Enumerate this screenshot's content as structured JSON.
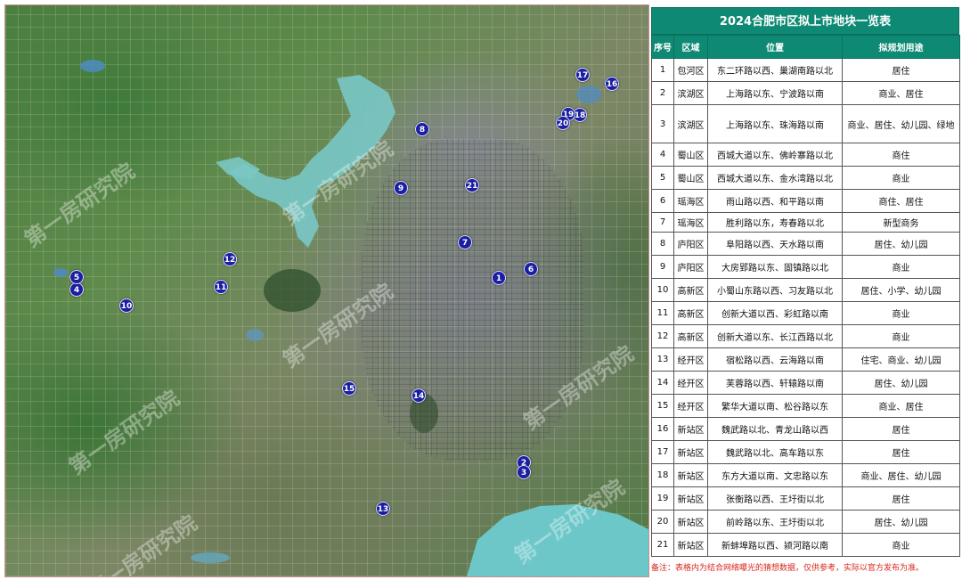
{
  "map": {
    "markers": [
      {
        "id": "1"
      },
      {
        "id": "2"
      },
      {
        "id": "3"
      },
      {
        "id": "4"
      },
      {
        "id": "5"
      },
      {
        "id": "6"
      },
      {
        "id": "7"
      },
      {
        "id": "8"
      },
      {
        "id": "9"
      },
      {
        "id": "10"
      },
      {
        "id": "11"
      },
      {
        "id": "12"
      },
      {
        "id": "13"
      },
      {
        "id": "14"
      },
      {
        "id": "15"
      },
      {
        "id": "16"
      },
      {
        "id": "17"
      },
      {
        "id": "18"
      },
      {
        "id": "19"
      },
      {
        "id": "20"
      },
      {
        "id": "21"
      }
    ],
    "watermark": "第一房研究院"
  },
  "table": {
    "title": "2024合肥市区拟上市地块一览表",
    "headers": [
      "序号",
      "区域",
      "位置",
      "拟规划用途"
    ],
    "rows": [
      [
        "1",
        "包河区",
        "东二环路以西、巢湖南路以北",
        "居住"
      ],
      [
        "2",
        "滨湖区",
        "上海路以东、宁波路以南",
        "商业、居住"
      ],
      [
        "3",
        "滨湖区",
        "上海路以东、珠海路以南",
        "商业、居住、幼儿园、绿地"
      ],
      [
        "4",
        "蜀山区",
        "西城大道以东、佛岭寨路以北",
        "商住"
      ],
      [
        "5",
        "蜀山区",
        "西城大道以东、金水湾路以北",
        "商业"
      ],
      [
        "6",
        "瑶海区",
        "雨山路以西、和平路以南",
        "商住、居住"
      ],
      [
        "7",
        "瑶海区",
        "胜利路以东，寿春路以北",
        "新型商务"
      ],
      [
        "8",
        "庐阳区",
        "阜阳路以西、天水路以南",
        "居住、幼儿园"
      ],
      [
        "9",
        "庐阳区",
        "大房郢路以东、固镇路以北",
        "商业"
      ],
      [
        "10",
        "高新区",
        "小蜀山东路以西、习友路以北",
        "居住、小学、幼儿园"
      ],
      [
        "11",
        "高新区",
        "创新大道以西、彩虹路以南",
        "商业"
      ],
      [
        "12",
        "高新区",
        "创新大道以东、长江西路以北",
        "商业"
      ],
      [
        "13",
        "经开区",
        "宿松路以西、云海路以南",
        "住宅、商业、幼儿园"
      ],
      [
        "14",
        "经开区",
        "芙蓉路以西、轩辕路以南",
        "居住、幼儿园"
      ],
      [
        "15",
        "经开区",
        "繁华大道以南、松谷路以东",
        "商业、居住"
      ],
      [
        "16",
        "新站区",
        "魏武路以北、青龙山路以西",
        "居住"
      ],
      [
        "17",
        "新站区",
        "魏武路以北、高车路以东",
        "居住"
      ],
      [
        "18",
        "新站区",
        "东方大道以南、文忠路以东",
        "商业、居住、幼儿园"
      ],
      [
        "19",
        "新站区",
        "张衡路以西、王圩街以北",
        "居住"
      ],
      [
        "20",
        "新站区",
        "前岭路以东、王圩街以北",
        "居住、幼儿园"
      ],
      [
        "21",
        "新站区",
        "新蚌埠路以西、颍河路以南",
        "商业"
      ]
    ],
    "note": "备注：表格内为结合网络曝光的猜想数据，仅供参考，实际以官方发布为准。"
  },
  "colors": {
    "header_bg": "#0e8a74",
    "marker": "#1b1fa0",
    "note": "#d9261c",
    "water": "#6fc7c9"
  }
}
